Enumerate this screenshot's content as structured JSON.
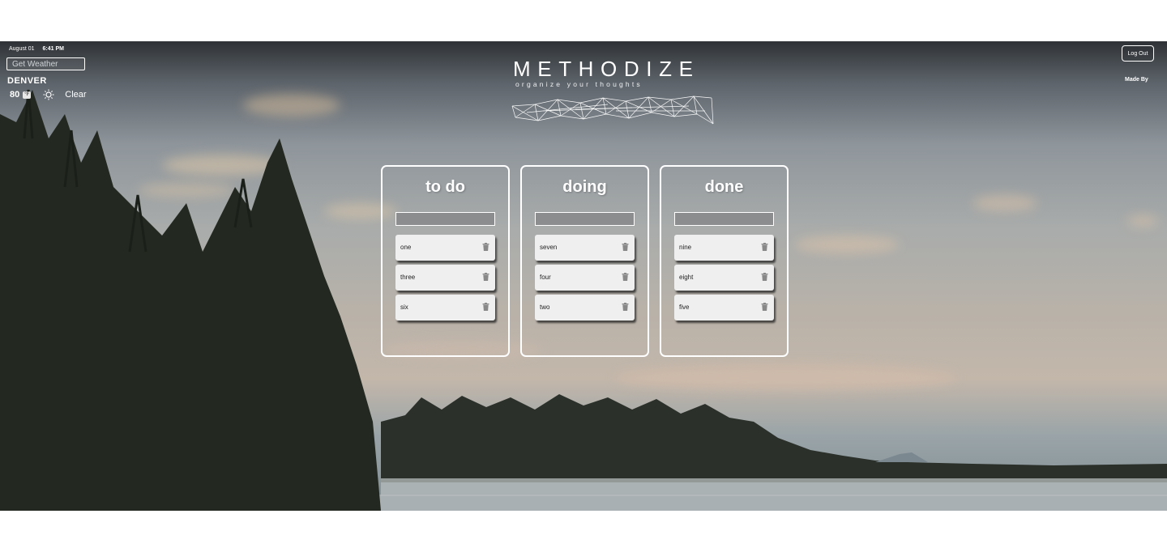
{
  "header": {
    "date": "August 01",
    "time": "6:41 PM",
    "logout_label": "Log Out",
    "made_by": "Made By"
  },
  "weather": {
    "placeholder": "Get Weather",
    "city": "DENVER",
    "temp": "80",
    "unit": "°F",
    "condition_icon": "sun-icon",
    "condition": "Clear"
  },
  "brand": {
    "title": "METHODIZE",
    "tagline": "organize your thoughts"
  },
  "board": {
    "columns": [
      {
        "title": "to do",
        "items": [
          "one",
          "three",
          "six"
        ]
      },
      {
        "title": "doing",
        "items": [
          "seven",
          "four",
          "two"
        ]
      },
      {
        "title": "done",
        "items": [
          "nine",
          "eight",
          "five"
        ]
      }
    ]
  },
  "colors": {
    "card_bg": "#efefef",
    "column_border": "#ffffff",
    "input_bg": "#8b8d8f"
  }
}
